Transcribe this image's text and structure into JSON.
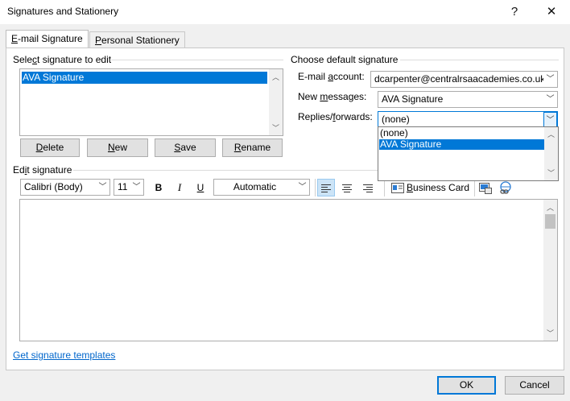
{
  "window": {
    "title": "Signatures and Stationery",
    "help_glyph": "?",
    "close_glyph": "✕"
  },
  "tabs": [
    {
      "label": "E-mail Signature",
      "key": "E"
    },
    {
      "label": "Personal Stationery",
      "key": "P"
    }
  ],
  "select_signature": {
    "label": "Select signature to edit",
    "items": [
      "AVA Signature"
    ],
    "selected": "AVA Signature"
  },
  "sig_buttons": [
    "Delete",
    "New",
    "Save",
    "Rename"
  ],
  "defaults": {
    "label": "Choose default signature",
    "email_account_label": "E-mail account:",
    "email_account_value": "dcarpenter@centralrsaacademies.co.uk",
    "new_messages_label": "New messages:",
    "new_messages_value": "AVA Signature",
    "replies_label": "Replies/forwards:",
    "replies_value": "(none)",
    "replies_options": [
      "(none)",
      "AVA Signature"
    ],
    "replies_highlighted": "AVA Signature"
  },
  "edit_signature": {
    "label": "Edit signature",
    "font": "Calibri (Body)",
    "size": "11",
    "bold": "B",
    "italic": "I",
    "underline": "U",
    "color": "Automatic",
    "business_card": "Business Card",
    "content": ""
  },
  "footer": {
    "templates_link": "Get signature templates",
    "ok": "OK",
    "cancel": "Cancel"
  },
  "colors": {
    "accent": "#0078d7",
    "link": "#0066cc"
  }
}
